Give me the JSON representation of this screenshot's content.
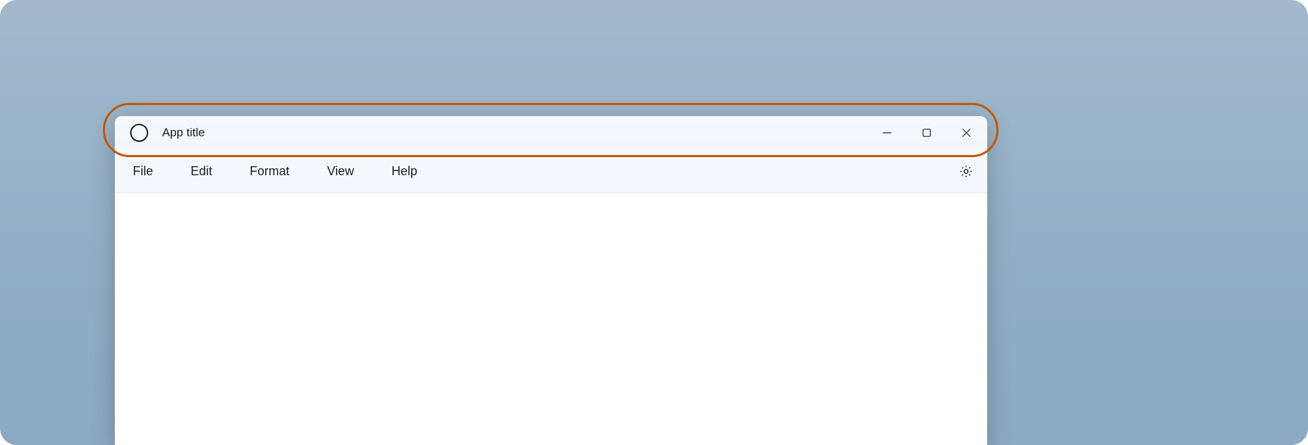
{
  "window": {
    "title": "App title"
  },
  "menubar": {
    "items": [
      {
        "label": "File"
      },
      {
        "label": "Edit"
      },
      {
        "label": "Format"
      },
      {
        "label": "View"
      },
      {
        "label": "Help"
      }
    ]
  },
  "colors": {
    "highlight": "#c15700",
    "background_desktop": "#99b3c9",
    "window_bg": "#ffffff",
    "titlebar_bg": "#f4f7fb"
  }
}
